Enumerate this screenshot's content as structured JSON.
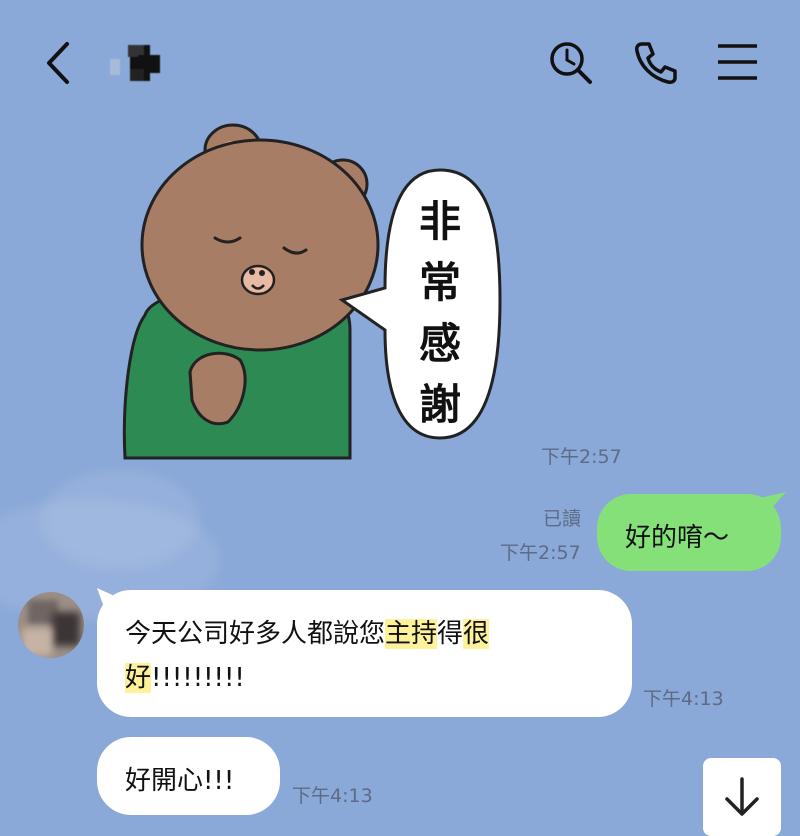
{
  "header": {
    "back_icon": "chevron-left-icon",
    "search_icon": "search-icon",
    "call_icon": "phone-icon",
    "menu_icon": "menu-icon"
  },
  "messages": [
    {
      "sticker_text": [
        "非",
        "常",
        "感",
        "謝"
      ],
      "time": "下午2:57"
    },
    {
      "read_receipt": "已讀",
      "time": "下午2:57",
      "text": "好的唷〜"
    },
    {
      "line1_a": "今天公司好多人都說您",
      "line1_hl1": "主持",
      "line1_b": "得",
      "line1_hl2": "很",
      "line2_hl": "好",
      "line2_b": "!!!!!!!!!",
      "time": "下午4:13"
    },
    {
      "text": "好開心!!!",
      "time": "下午4:13"
    }
  ],
  "colors": {
    "background": "#8aa8d8",
    "outgoing_bubble": "#85e07a",
    "incoming_bubble": "#ffffff",
    "highlight": "#fdf29a"
  }
}
